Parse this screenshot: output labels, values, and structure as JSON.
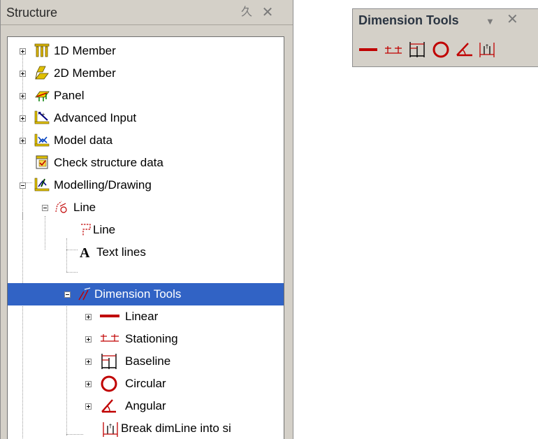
{
  "structure_panel": {
    "title": "Structure",
    "pin_glyph": "久",
    "close_glyph": "✕",
    "tree": {
      "member_1d": "1D Member",
      "member_2d": "2D Member",
      "panel": "Panel",
      "advanced_input": "Advanced Input",
      "model_data": "Model data",
      "check_structure_data": "Check structure data",
      "modelling_drawing": "Modelling/Drawing",
      "line_group": "Line",
      "line_item": "Line",
      "text_lines": "Text lines",
      "dimension_tools": "Dimension Tools",
      "linear": "Linear",
      "stationing": "Stationing",
      "baseline": "Baseline",
      "circular": "Circular",
      "angular": "Angular",
      "break_dimline": "Break dimLine into si"
    }
  },
  "toolbar": {
    "title": "Dimension Tools",
    "menu_glyph": "▼",
    "close_glyph": "✕",
    "buttons": [
      "linear-dimension-icon",
      "stationing-icon",
      "baseline-icon",
      "circular-icon",
      "angular-icon",
      "break-dimline-icon"
    ]
  },
  "colors": {
    "selection": "#3163c5",
    "dimension_red": "#c00000",
    "panel_bg": "#d4d0c8"
  }
}
